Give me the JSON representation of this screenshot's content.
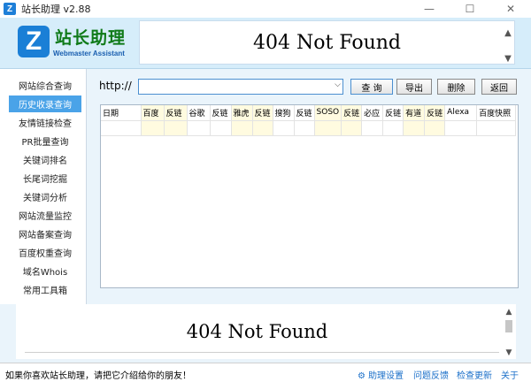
{
  "window": {
    "icon_letter": "Z",
    "title": "站长助理 v2.88",
    "minimize": "—",
    "maximize": "☐",
    "close": "✕"
  },
  "header": {
    "logo_letter": "Z",
    "logo_cn": "站长助理",
    "logo_en": "Webmaster Assistant",
    "banner_text": "404 Not Found"
  },
  "sidebar": {
    "items": [
      {
        "label": "网站综合查询",
        "active": false
      },
      {
        "label": "历史收录查询",
        "active": true
      },
      {
        "label": "友情链接检查",
        "active": false
      },
      {
        "label": "PR批量查询",
        "active": false
      },
      {
        "label": "关键词排名",
        "active": false
      },
      {
        "label": "长尾词挖掘",
        "active": false
      },
      {
        "label": "关键词分析",
        "active": false
      },
      {
        "label": "网站流量监控",
        "active": false
      },
      {
        "label": "网站备案查询",
        "active": false
      },
      {
        "label": "百度权重查询",
        "active": false
      },
      {
        "label": "域名Whois",
        "active": false
      },
      {
        "label": "常用工具箱",
        "active": false
      }
    ]
  },
  "toolbar": {
    "url_prefix": "http://",
    "url_value": "",
    "query": "查 询",
    "export": "导出",
    "delete": "删除",
    "back": "返回"
  },
  "table": {
    "columns": [
      "日期",
      "百度",
      "反链",
      "谷歌",
      "反链",
      "雅虎",
      "反链",
      "搜狗",
      "反链",
      "SOSO",
      "反链",
      "必应",
      "反链",
      "有道",
      "反链",
      "Alexa",
      "百度快照"
    ]
  },
  "bottom": {
    "banner_text": "404 Not Found"
  },
  "status": {
    "message": "如果你喜欢站长助理，请把它介绍给你的朋友！",
    "settings": "助理设置",
    "feedback": "问题反馈",
    "update": "检查更新",
    "about": "关于"
  },
  "colors": {
    "accent": "#4aa3e8",
    "header_bg": "#d6edfa",
    "logo_green": "#0f7a18",
    "link": "#1a6fc9"
  }
}
